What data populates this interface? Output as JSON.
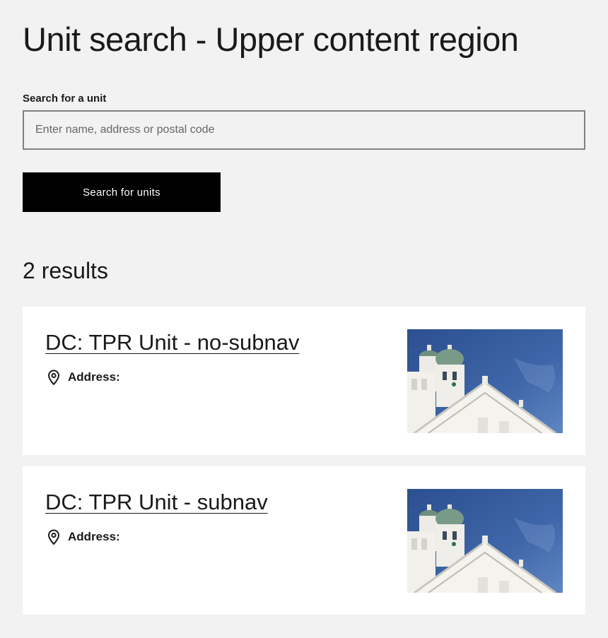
{
  "page": {
    "title": "Unit search - Upper content region"
  },
  "search": {
    "label": "Search for a unit",
    "placeholder": "Enter name, address or postal code",
    "value": "",
    "button_label": "Search for units"
  },
  "results": {
    "count_label": "2 results",
    "items": [
      {
        "title": "DC: TPR Unit - no-subnav",
        "address_label": "Address:",
        "icon": "location-pin-icon",
        "image": "cathedral-photo"
      },
      {
        "title": "DC: TPR Unit - subnav",
        "address_label": "Address:",
        "icon": "location-pin-icon",
        "image": "cathedral-photo"
      }
    ]
  },
  "colors": {
    "page_background": "#f2f2f2",
    "card_background": "#ffffff",
    "button_background": "#000000",
    "button_text": "#ffffff",
    "input_border": "#808080",
    "text": "#1a1a1a"
  }
}
